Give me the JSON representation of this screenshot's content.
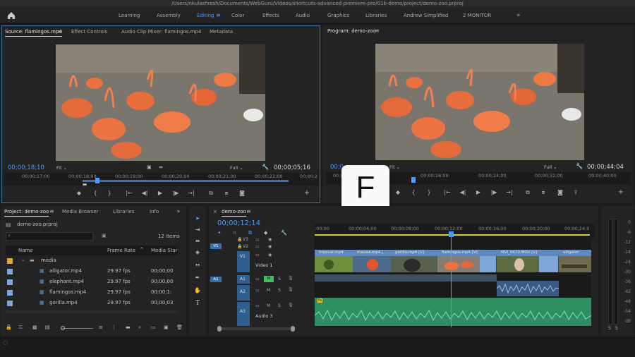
{
  "window": {
    "title": "/Users/nkulashresh/Documents/WebGuru/Videos/shortcuts-advanced-premiere-pro/01b-demo/project/demo-zoo.prproj"
  },
  "workspaces": {
    "items": [
      "Learning",
      "Assembly",
      "Editing",
      "Color",
      "Effects",
      "Audio",
      "Graphics",
      "Libraries",
      "Andrew Simplified",
      "2 MONITOR"
    ],
    "active": "Editing",
    "more": "»"
  },
  "source": {
    "tabs": [
      "Source: flamingos.mp4",
      "Effect Controls",
      "Audio Clip Mixer: flamingos.mp4",
      "Metadata"
    ],
    "menu": "≡",
    "timecode_in": "00;00;18;10",
    "fit": "Fit",
    "quality": "Full",
    "timecode_dur": "00;00;05;16",
    "ticks": [
      "00;00;17;00",
      "00;00;18;00",
      "00;00;19;00",
      "00;00;20;00",
      "00;00;21;00",
      "00;00;22;00",
      "00;00;2"
    ]
  },
  "program": {
    "title": "Program: demo-zoo",
    "menu": "≡",
    "timecode_in": "00;0",
    "fit": "Fit",
    "quality": "Full",
    "timecode_dur": "00;00;44;04",
    "ticks": [
      "00;00",
      "00;00;16;00",
      "00;00;24;00",
      "00;00;32;00",
      "00;00;40;00"
    ]
  },
  "shortcut_overlay": {
    "key": "F"
  },
  "project": {
    "tabs": [
      "Project: demo-zoo",
      "Media Browser",
      "Libraries",
      "Info"
    ],
    "menu": "≡",
    "more": "»",
    "file": "demo-zoo.prproj",
    "search_placeholder": "",
    "items_count": "12 Items",
    "columns": [
      "Name",
      "Frame Rate",
      "Media Star"
    ],
    "folder": "media",
    "rows": [
      {
        "name": "alligator.mp4",
        "fps": "29.97 fps",
        "start": "00;00;00"
      },
      {
        "name": "elephant.mp4",
        "fps": "29.97 fps",
        "start": "00;00;00"
      },
      {
        "name": "flamingos.mp4",
        "fps": "29.97 fps",
        "start": "00;00;1:"
      },
      {
        "name": "gorilla.mp4",
        "fps": "29.97 fps",
        "start": "00;00;03"
      }
    ]
  },
  "timeline": {
    "tab": "demo-zoo",
    "close": "×",
    "menu": "≡",
    "timecode": "00;00;12;14",
    "ticks": [
      ";00;00",
      "00;00;04;00",
      "00;00;08;00",
      "00;00;12;00",
      "00;00;16;00",
      "00;00;20;00",
      "00;00;24;0"
    ],
    "tracks": {
      "v3": "V3",
      "v2": "V2",
      "v1": "V1",
      "video1": "Video 1",
      "a1": "A1",
      "a2": "A2",
      "a3": "A3",
      "audio3": "Audio 3",
      "m": "M",
      "s": "S"
    },
    "src_v1": "V1",
    "src_a1": "A1",
    "clips": [
      {
        "name": "tropical.mp4",
        "badge": "fx"
      },
      {
        "name": "macaw.mp4 [",
        "badge": "fx"
      },
      {
        "name": "gorilla.mp4 [V]",
        "badge": "fx"
      },
      {
        "name": "flamingos.mp4 [V]",
        "badge": "fx"
      },
      {
        "name": "MVI_0670.MOV [V]",
        "badge": "fx"
      },
      {
        "name": "alligator",
        "badge": "fx"
      }
    ],
    "audio_fx": "fx"
  },
  "meter": {
    "scale": [
      "0",
      "-6",
      "-12",
      "-18",
      "-24",
      "-30",
      "-36",
      "-42",
      "-48",
      "-54",
      "dB"
    ],
    "solo": [
      "S",
      "S"
    ]
  },
  "colors": {
    "accent": "#3f9eff",
    "clip_blue": "#7ea7d8",
    "audio_green": "#2f8f62",
    "track_blue": "#2f5f92"
  }
}
